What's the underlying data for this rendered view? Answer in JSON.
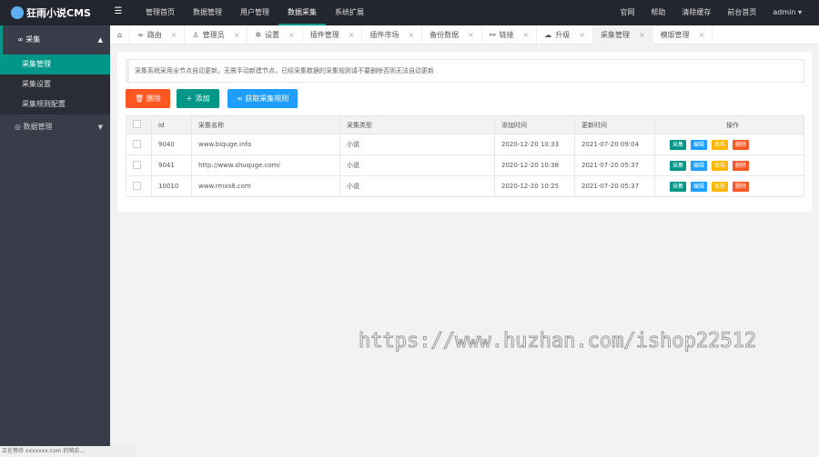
{
  "app": {
    "title": "狂雨小说CMS"
  },
  "topnav": [
    "管理首页",
    "数据管理",
    "用户管理",
    "数据采集",
    "系统扩展"
  ],
  "topnav_active": 3,
  "rightnav": [
    "官网",
    "帮助",
    "清除缓存",
    "前台首页",
    "admin ▾"
  ],
  "sidebar": {
    "group1": "采集",
    "items": [
      "采集管理",
      "采集设置",
      "采集规则配置"
    ],
    "group2": "数据管理"
  },
  "tabs": [
    "路由",
    "管理员",
    "设置",
    "插件管理",
    "插件市场",
    "备份数据",
    "链接",
    "升级",
    "采集管理",
    "模版管理"
  ],
  "notice": "采集系统采用全节点自动更新，无需手动新建节点，已经采集数据的采集规则请不要删除否则无法自动更新",
  "buttons": {
    "delete": "删除",
    "add": "添加",
    "fetch": "获取采集规则"
  },
  "table": {
    "headers": [
      "id",
      "采集名称",
      "采集类型",
      "添加时间",
      "更新时间",
      "操作"
    ],
    "rows": [
      [
        "9040",
        "www.biquge.info",
        "小说",
        "2020-12-20 10:33",
        "2021-07-20 09:04"
      ],
      [
        "9041",
        "http://www.shuquge.com/",
        "小说",
        "2020-12-20 10:38",
        "2021-07-20 05:37"
      ],
      [
        "10010",
        "www.rmxs8.com",
        "小说",
        "2020-12-20 10:25",
        "2021-07-20 05:37"
      ]
    ],
    "actions": [
      "采集",
      "编辑",
      "发布",
      "删除"
    ]
  },
  "watermark": "https://www.huzhan.com/ishop22512",
  "status": "正在等待 xxxxxxx.com 的响应...",
  "colors": {
    "accent": "#009688",
    "danger": "#ff5722",
    "info": "#1e9fff",
    "warn": "#ffb800"
  }
}
